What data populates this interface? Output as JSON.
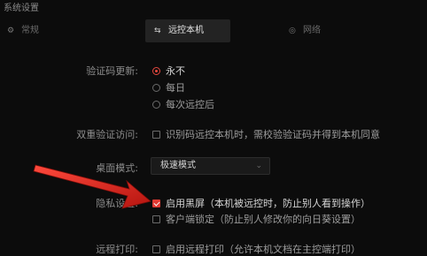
{
  "window": {
    "title": "系统设置"
  },
  "tabs": [
    {
      "label": "常规",
      "icon": "gear-icon"
    },
    {
      "label": "远控本机",
      "icon": "remote-icon"
    },
    {
      "label": "网络",
      "icon": "network-icon"
    }
  ],
  "settings": {
    "code_update": {
      "label": "验证码更新:",
      "options": [
        "永不",
        "每日",
        "每次远控后"
      ],
      "selected": "永不"
    },
    "two_factor": {
      "label": "双重验证访问:",
      "text": "识别码远控本机时，需校验验证码并得到本机同意",
      "checked": false
    },
    "desktop_mode": {
      "label": "桌面模式:",
      "value": "极速模式"
    },
    "privacy": {
      "label": "隐私设置:",
      "options": [
        {
          "text": "启用黑屏（本机被远控时，防止别人看到操作）",
          "checked": true
        },
        {
          "text": "客户端锁定（防止别人修改你的向日葵设置）",
          "checked": false
        }
      ]
    },
    "remote_print": {
      "label": "远程打印:",
      "text": "启用远程打印（允许本机文档在主控端打印）",
      "checked": false
    }
  },
  "colors": {
    "accent": "#e13a33",
    "background": "#0c0c0c",
    "arrow": "#d2241e"
  }
}
